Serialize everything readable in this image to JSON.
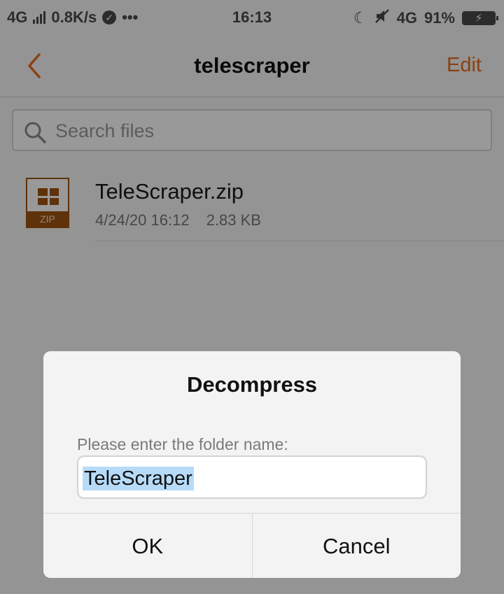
{
  "status_bar": {
    "network": "4G",
    "speed": "0.8K/s",
    "more": "•••",
    "time": "16:13",
    "network_right": "4G",
    "battery": "91%",
    "icons": [
      "signal-bars-icon",
      "check-circle-icon",
      "moon-icon",
      "mute-icon",
      "battery-charging-icon"
    ]
  },
  "header": {
    "title": "telescraper",
    "edit_label": "Edit",
    "accent_color": "#e86d1f"
  },
  "search": {
    "placeholder": "Search files",
    "value": ""
  },
  "files": [
    {
      "name": "TeleScraper.zip",
      "date": "4/24/20 16:12",
      "size": "2.83 KB",
      "icon_label": "ZIP",
      "icon_color": "#9e5411"
    }
  ],
  "dialog": {
    "title": "Decompress",
    "prompt": "Please enter the folder name:",
    "folder_name": "TeleScraper",
    "ok_label": "OK",
    "cancel_label": "Cancel",
    "selection_color": "#b7dbf7"
  }
}
